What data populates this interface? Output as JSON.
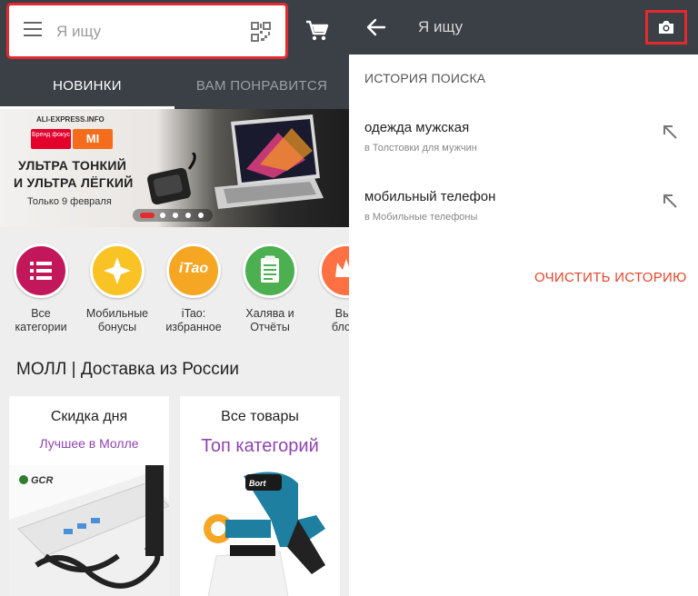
{
  "left": {
    "search": {
      "placeholder": "Я ищу"
    },
    "tabs": [
      {
        "label": "НОВИНКИ",
        "active": true
      },
      {
        "label": "ВАМ ПОНРАВИТСЯ",
        "active": false
      }
    ],
    "banner": {
      "site": "ALI-EXPRESS.INFO",
      "brand_badge": "Бренд фокус",
      "mi_badge": "MI",
      "title_line1": "УЛЬТРА ТОНКИЙ",
      "title_line2": "И УЛЬТРА ЛЁГКИЙ",
      "date": "Только 9 февраля",
      "slides_total": 5,
      "slide_active": 1
    },
    "categories": [
      {
        "label1": "Все",
        "label2": "категории",
        "color": "#c2185b",
        "icon": "list-icon"
      },
      {
        "label1": "Мобильные",
        "label2": "бонусы",
        "color": "#f9c325",
        "icon": "star-icon"
      },
      {
        "label1": "iTao:",
        "label2": "избранное",
        "color": "#f5a623",
        "icon": "itao-logo-icon",
        "logo_text": "iTao"
      },
      {
        "label1": "Халява и",
        "label2": "Отчёты",
        "color": "#4caf50",
        "icon": "clipboard-icon"
      },
      {
        "label1": "Выб",
        "label2": "блоге",
        "color": "#ff7043",
        "icon": "crown-icon"
      }
    ],
    "moll_title": "МОЛЛ | Доставка из России",
    "cards": [
      {
        "title": "Скидка дня",
        "subtitle": "Лучшее в Молле",
        "brand": "GCR"
      },
      {
        "title": "Все товары",
        "subtitle": "Топ категорий",
        "brand": "Bort"
      }
    ]
  },
  "right": {
    "title": "Я ищу",
    "history_title": "ИСТОРИЯ ПОИСКА",
    "history": [
      {
        "query": "одежда мужская",
        "category": "в Толстовки для мужчин"
      },
      {
        "query": "мобильный телефон",
        "category": "в Мобильные телефоны"
      }
    ],
    "clear_label": "ОЧИСТИТЬ ИСТОРИЮ"
  },
  "colors": {
    "header_bg": "#3b3f46",
    "highlight": "#e32a2f",
    "accent_purple": "#8e44ad",
    "clear_red": "#e5462d"
  }
}
